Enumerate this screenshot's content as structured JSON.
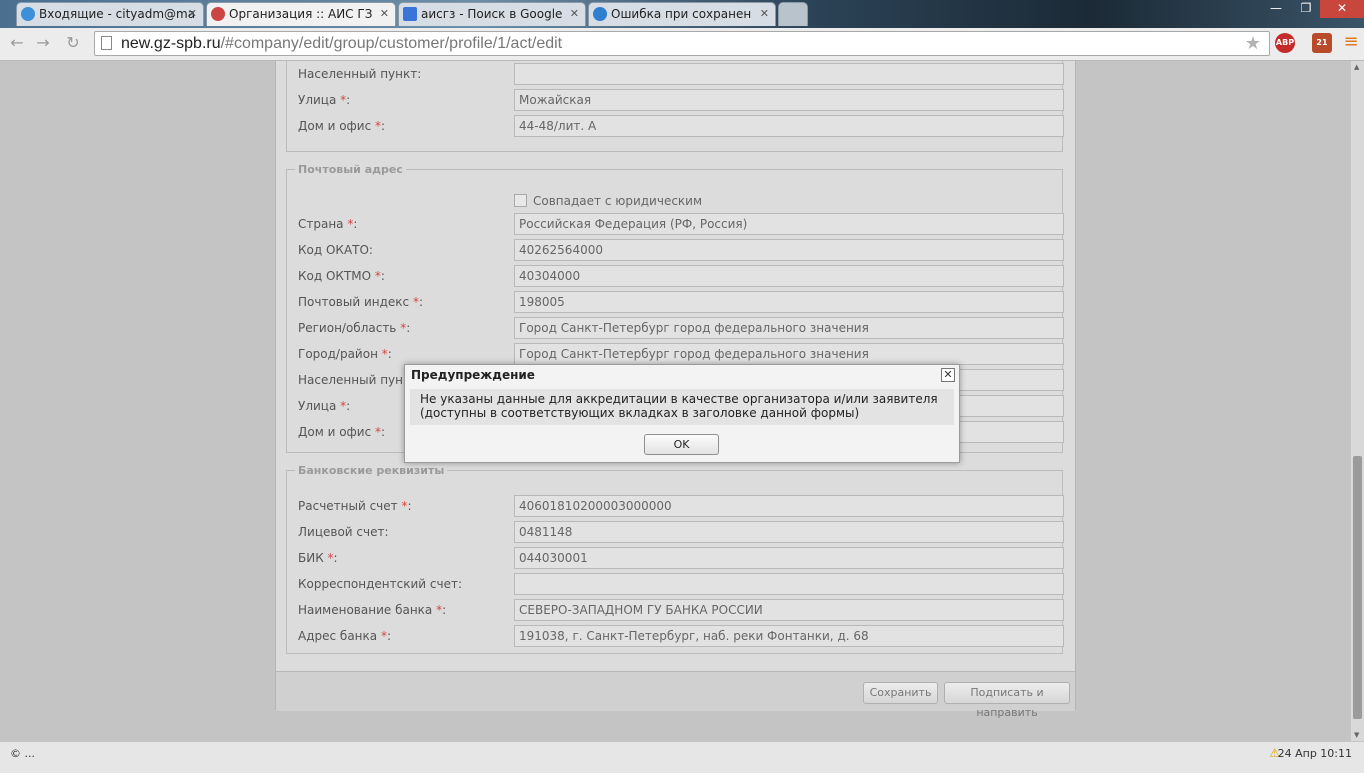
{
  "browser": {
    "tabs": [
      {
        "title": "Входящие - cityadm@ma",
        "icon_color": "#3c8fd8"
      },
      {
        "title": "Организация :: АИС ГЗ",
        "icon_color": "#c44"
      },
      {
        "title": "аисгз - Поиск в Google",
        "icon_color": "#3a74d8"
      },
      {
        "title": "Ошибка при сохранен",
        "icon_color": "#2f7fd1"
      }
    ],
    "active_tab_index": 1,
    "url_host": "new.gz-spb.ru",
    "url_path": "/#company/edit/group/customer/profile/1/act/edit",
    "ext_abp": "ABP",
    "ext_badge": "21",
    "window_controls": {
      "minimize": "—",
      "maximize": "❐",
      "close": "✕"
    }
  },
  "form": {
    "top_rows": [
      {
        "label": "Населенный пункт:",
        "required": false,
        "value": ""
      },
      {
        "label": "Улица ",
        "required": true,
        "value": "Можайская"
      },
      {
        "label": "Дом и офис ",
        "required": true,
        "value": "44-48/лит. А"
      }
    ],
    "postal": {
      "legend": "Почтовый адрес",
      "same_checkbox_label": "Совпадает с юридическим",
      "rows": [
        {
          "label": "Страна ",
          "required": true,
          "value": "Российская Федерация (РФ, Россия)"
        },
        {
          "label": "Код ОКАТО:",
          "required": false,
          "value": "40262564000"
        },
        {
          "label": "Код ОКТМО ",
          "required": true,
          "value": "40304000"
        },
        {
          "label": "Почтовый индекс ",
          "required": true,
          "value": "198005"
        },
        {
          "label": "Регион/область ",
          "required": true,
          "value": "Город Санкт-Петербург город федерального значения"
        },
        {
          "label": "Город/район ",
          "required": true,
          "value": "Город Санкт-Петербург город федерального значения"
        },
        {
          "label": "Населенный пункт:",
          "required": false,
          "value": ""
        },
        {
          "label": "Улица ",
          "required": true,
          "value": ""
        },
        {
          "label": "Дом и офис ",
          "required": true,
          "value": ""
        }
      ]
    },
    "bank": {
      "legend": "Банковские реквизиты",
      "rows": [
        {
          "label": "Расчетный счет ",
          "required": true,
          "value": "40601810200003000000"
        },
        {
          "label": "Лицевой счет:",
          "required": false,
          "value": "0481148"
        },
        {
          "label": "БИК ",
          "required": true,
          "value": "044030001"
        },
        {
          "label": "Корреспондентский счет:",
          "required": false,
          "value": ""
        },
        {
          "label": "Наименование банка ",
          "required": true,
          "value": "СЕВЕРО-ЗАПАДНОМ ГУ БАНКА РОССИИ"
        },
        {
          "label": "Адрес банка ",
          "required": true,
          "value": "191038, г. Санкт-Петербург, наб. реки Фонтанки, д. 68"
        }
      ]
    },
    "required_mark": "*",
    "required_suffix": ":",
    "save_label": "Сохранить",
    "sign_label": "Подписать и направить"
  },
  "dialog": {
    "title": "Предупреждение",
    "message": "Не указаны данные для аккредитации в качестве организатора и/или заявителя (доступны в соответствующих вкладках в заголовке данной формы)",
    "ok_label": "OK",
    "close_glyph": "✕"
  },
  "status": {
    "left": "© ...",
    "datetime": "24 Апр 10:11"
  }
}
